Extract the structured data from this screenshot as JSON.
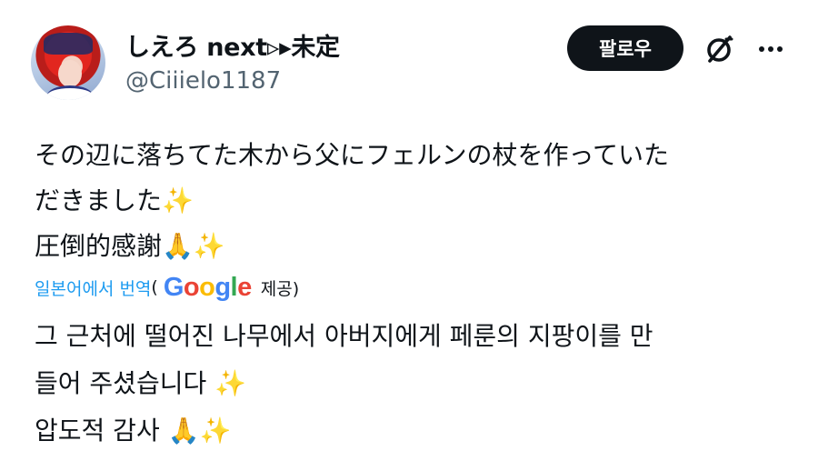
{
  "profile": {
    "display_name": "しえろ next▹▸未定",
    "handle": "@Ciiielo1187"
  },
  "actions": {
    "follow_label": "팔로우",
    "grok_icon": "slashed-circle-icon",
    "more_icon": "more-dots-icon"
  },
  "post": {
    "text": "その辺に落ちてた木から父にフェルンの杖を作っていた\nだきました✨\n圧倒的感謝🙏✨"
  },
  "translation": {
    "link_label": "일본어에서 번역",
    "open_paren": "(",
    "provider": "Google",
    "provided_label": "제공)"
  },
  "translated": {
    "text": "그 근처에 떨어진 나무에서 아버지에게 페룬의 지팡이를 만\n들어 주셨습니다 ✨\n압도적 감사 🙏✨"
  },
  "colors": {
    "link": "#1d9bf0",
    "handle": "#536471",
    "button_bg": "#0f1419"
  }
}
